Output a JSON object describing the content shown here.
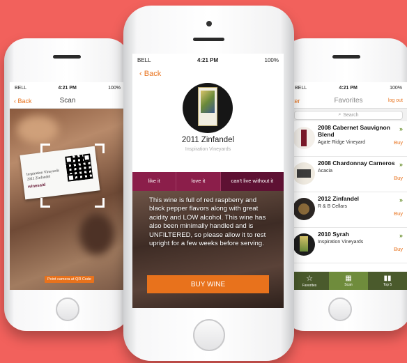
{
  "status": {
    "carrier": "BELL",
    "time": "4:21 PM",
    "battery": "100%"
  },
  "scan": {
    "back_label": "Back",
    "title": "Scan",
    "card_lines": [
      "Inspiration Vineyards",
      "2011 Zinfandel"
    ],
    "card_logo": "winesaid",
    "hint": "Point camera at QR Code"
  },
  "main": {
    "back_label": "Back",
    "wine_name": "2011 Zinfandel",
    "winery": "Inspiration Vineyards",
    "rating_options": [
      "like it",
      "love it",
      "can't live without it"
    ],
    "description": "This wine is full of red raspberry and black pepper flavors along with great acidity and LOW alcohol. This wine has also been minimally handled and is UNFILTERED, so please allow it to rest upright for a few weeks before serving.",
    "buy_label": "BUY WINE"
  },
  "favorites": {
    "left_label": "ilter",
    "title": "Favorites",
    "right_label": "log out",
    "search_placeholder": "Search",
    "buy_label": "Buy",
    "items": [
      {
        "title": "2008 Cabernet Sauvignon Blend",
        "winery": "Agate Ridge Vineyard"
      },
      {
        "title": "2008 Chardonnay Carneros",
        "winery": "Acacia"
      },
      {
        "title": "2012 Zinfandel",
        "winery": "R & B Cellars"
      },
      {
        "title": "2010 Syrah",
        "winery": "Inspiration Vineyards"
      }
    ],
    "tabs": [
      {
        "label": "Favorites",
        "icon": "star-icon"
      },
      {
        "label": "Scan",
        "icon": "qr-icon"
      },
      {
        "label": "Top 5",
        "icon": "bar-chart-icon"
      }
    ]
  },
  "colors": {
    "background": "#f2615c",
    "accent": "#e8721c",
    "wine": "#8b1e4a",
    "green": "#6f8c3c"
  }
}
